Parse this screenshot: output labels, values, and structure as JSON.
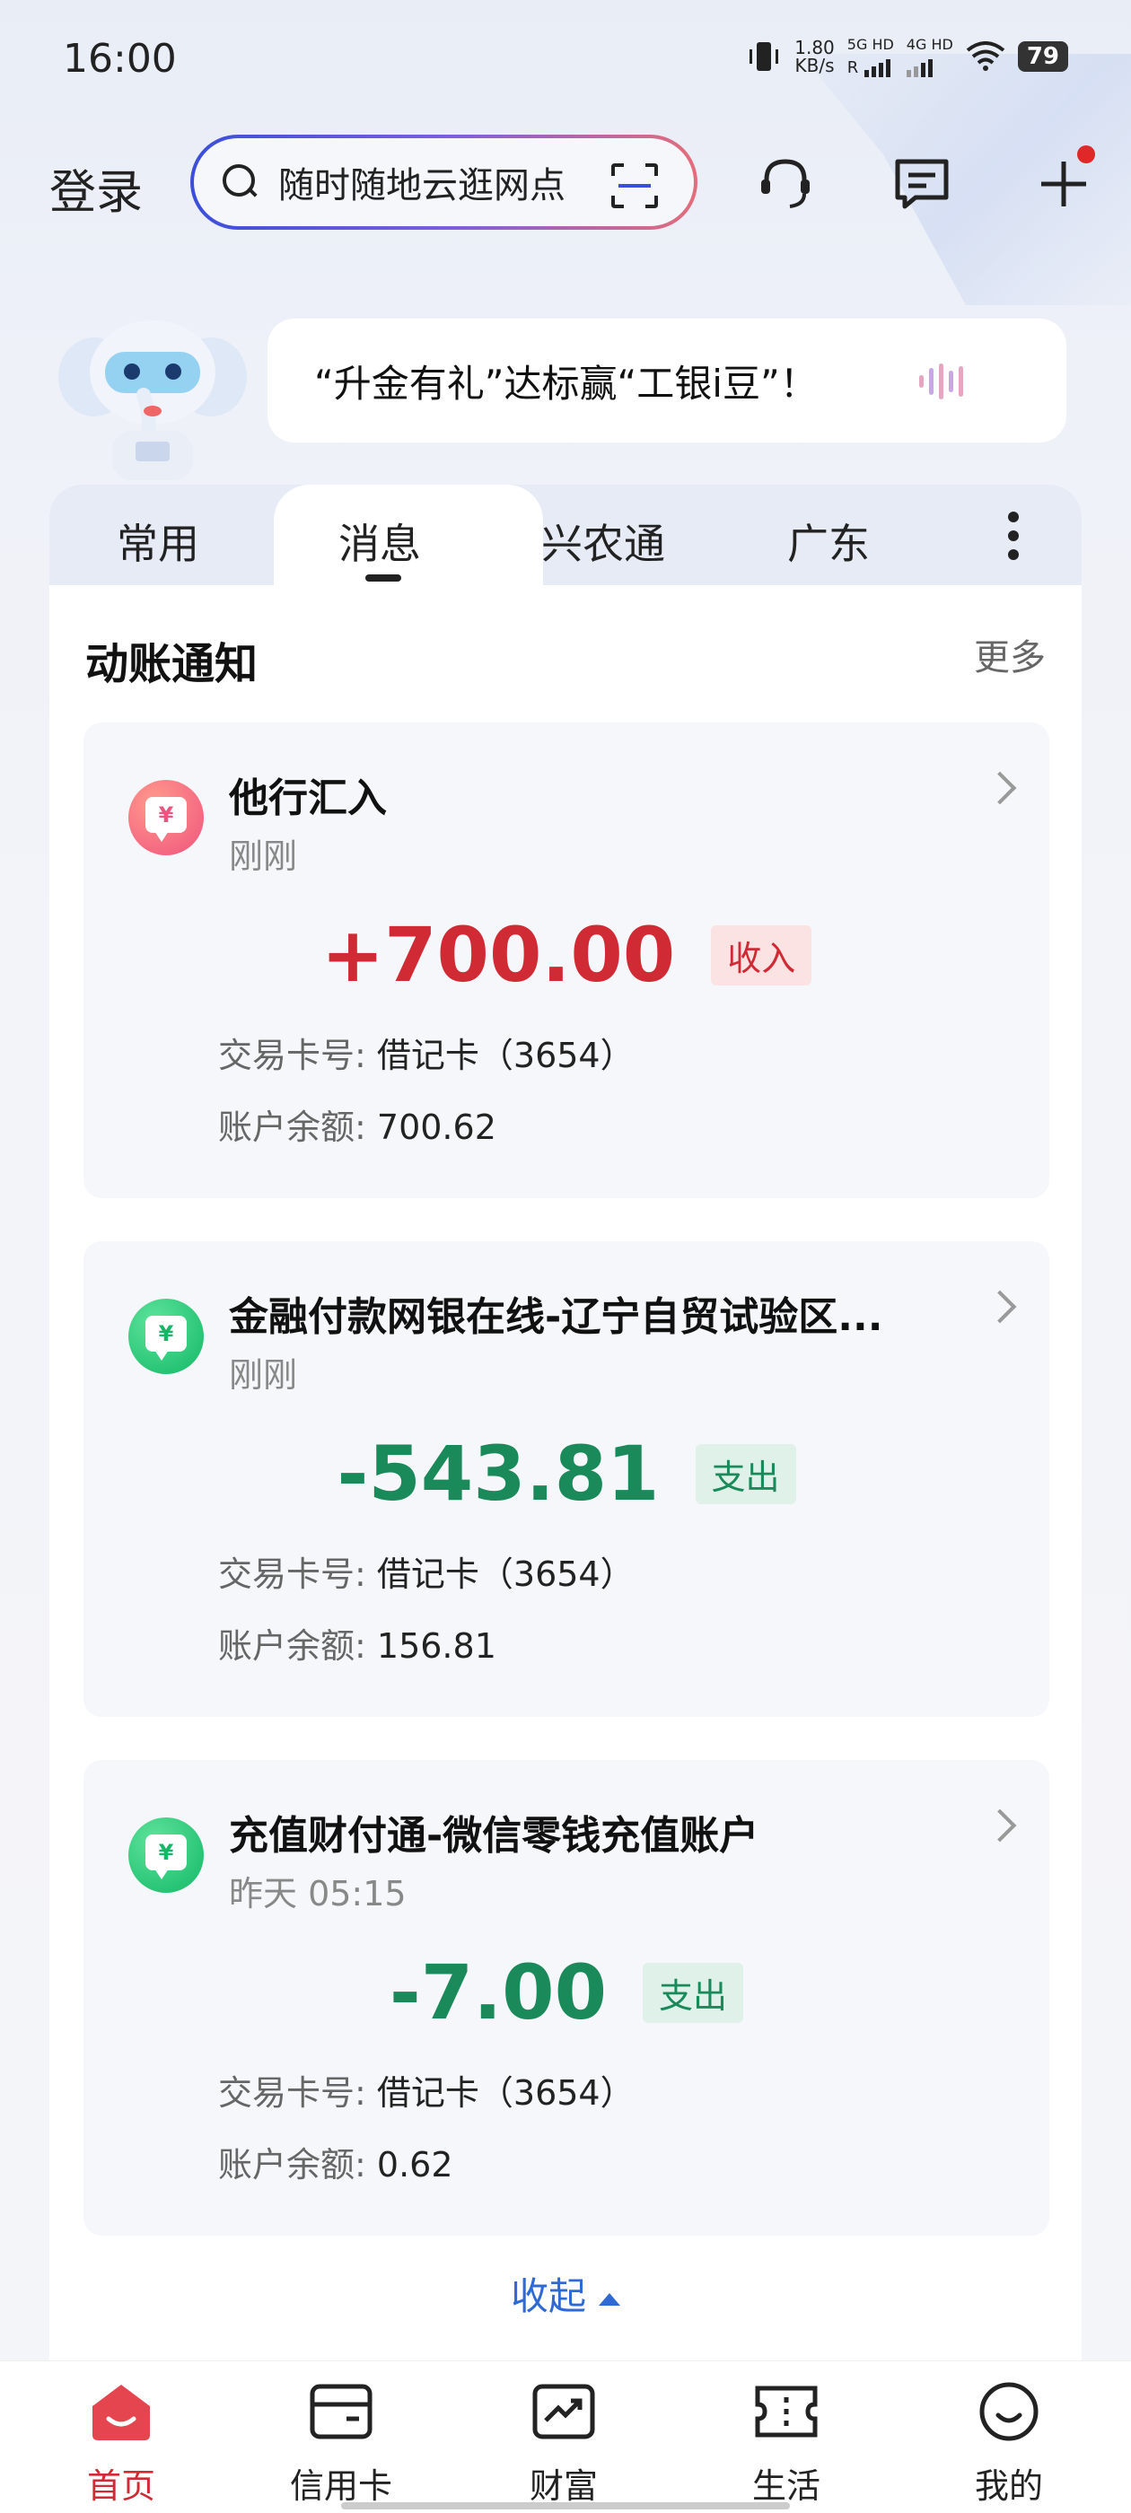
{
  "status_bar": {
    "time": "16:00",
    "net_speed": "1.80",
    "net_unit": "KB/s",
    "sim1": "5G HD",
    "sim1_sub": "R",
    "sim2": "4G HD",
    "battery": "79"
  },
  "header": {
    "login_label": "登录",
    "search_placeholder": "随时随地云逛网点",
    "icons": [
      "scan-icon",
      "customer-service-icon",
      "message-icon",
      "plus-icon"
    ]
  },
  "banner": {
    "text": "“升金有礼”达标赢“工银i豆”！"
  },
  "tabs": [
    {
      "label": "常用",
      "active": false
    },
    {
      "label": "消息",
      "active": true
    },
    {
      "label": "兴农通",
      "active": false
    },
    {
      "label": "广东",
      "active": false
    }
  ],
  "section": {
    "title": "动账通知",
    "more": "更多"
  },
  "notices": [
    {
      "title": "他行汇入",
      "time": "刚刚",
      "amount": "+700.00",
      "tag": "收入",
      "card_label": "交易卡号:",
      "card_value": "借记卡（3654）",
      "balance_label": "账户余额:",
      "balance_value": "700.62"
    },
    {
      "title": "金融付款网银在线-辽宁自贸试验区...",
      "time": "刚刚",
      "amount": "-543.81",
      "tag": "支出",
      "card_label": "交易卡号:",
      "card_value": "借记卡（3654）",
      "balance_label": "账户余额:",
      "balance_value": "156.81"
    },
    {
      "title": "充值财付通-微信零钱充值账户",
      "time": "昨天 05:15",
      "amount": "-7.00",
      "tag": "支出",
      "card_label": "交易卡号:",
      "card_value": "借记卡（3654）",
      "balance_label": "账户余额:",
      "balance_value": "0.62"
    }
  ],
  "collapse_label": "收起",
  "bottom_nav": [
    {
      "label": "首页",
      "icon": "home-icon",
      "active": true
    },
    {
      "label": "信用卡",
      "icon": "credit-card-icon",
      "active": false
    },
    {
      "label": "财富",
      "icon": "wealth-chart-icon",
      "active": false
    },
    {
      "label": "生活",
      "icon": "ticket-icon",
      "active": false
    },
    {
      "label": "我的",
      "icon": "profile-smile-icon",
      "active": false
    }
  ],
  "colors": {
    "income": "#d02a35",
    "expense": "#1a8a5a",
    "accent_blue": "#2f6ad4"
  }
}
